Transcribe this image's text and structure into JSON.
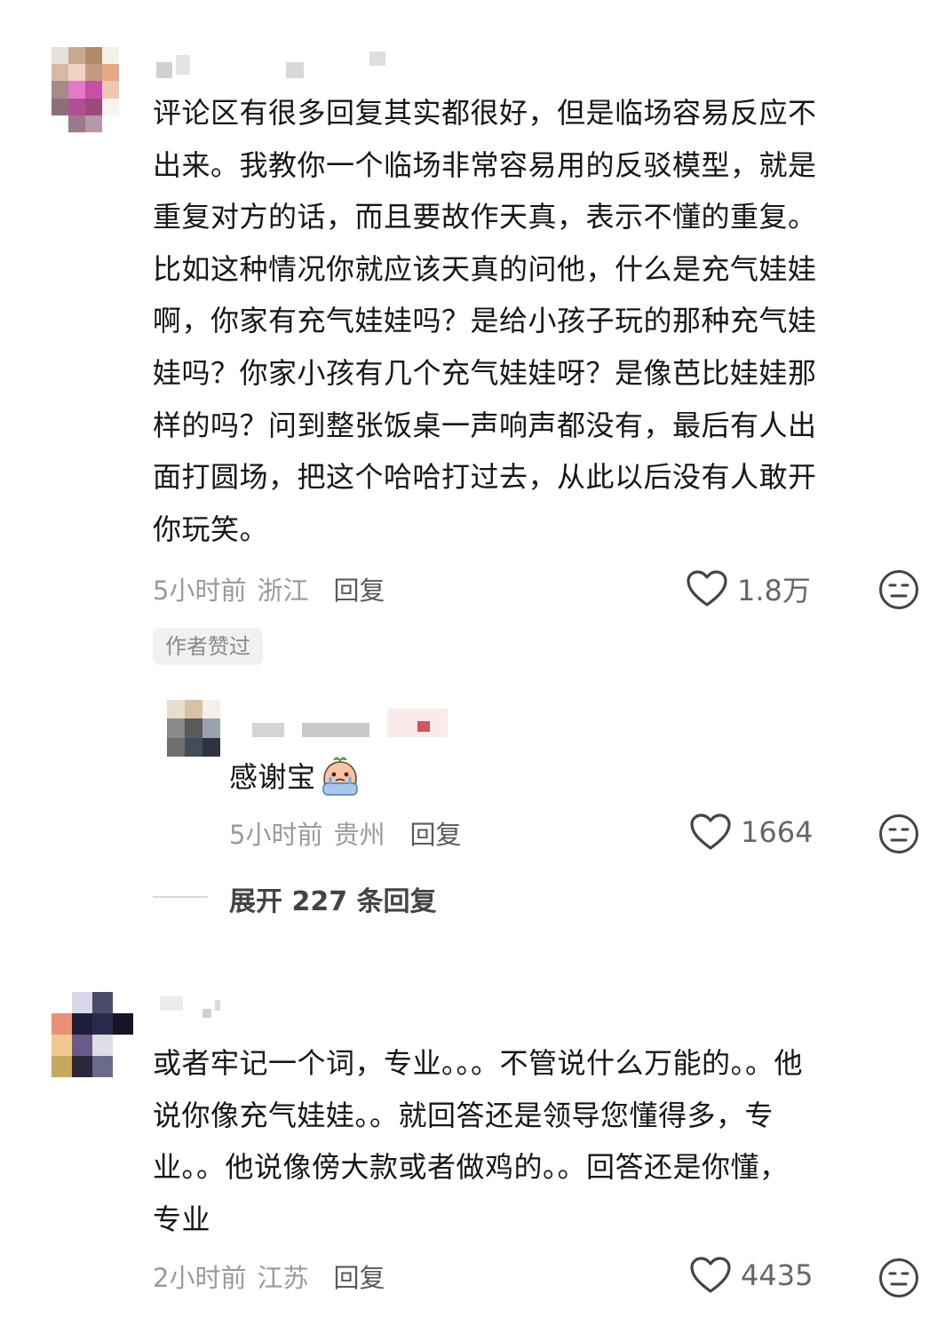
{
  "comments": [
    {
      "text": "评论区有很多回复其实都很好，但是临场容易反应不\n出来。我教你一个临场非常容易用的反驳模型，就是\n重复对方的话，而且要故作天真，表示不懂的重复。\n比如这种情况你就应该天真的问他，什么是充气娃娃\n啊，你家有充气娃娃吗？是给小孩子玩的那种充气娃\n娃吗？你家小孩有几个充气娃娃呀？是像芭比娃娃那\n样的吗？问到整张饭桌一声响声都没有，最后有人出\n面打圆场，把这个哈哈打过去，从此以后没有人敢开\n你玩笑。",
      "time": "5小时前",
      "location": "浙江",
      "reply_label": "回复",
      "likes": "1.8万",
      "badge": "作者赞过",
      "replies": [
        {
          "text": "感谢宝",
          "emoji": "crying-emoji",
          "time": "5小时前",
          "location": "贵州",
          "reply_label": "回复",
          "likes": "1664"
        }
      ],
      "expand_label": "展开 227 条回复"
    },
    {
      "text": "或者牢记一个词，专业。。。不管说什么万能的。。他\n说你像充气娃娃。。就回答还是领导您懂得多，专\n业。。他说像傍大款或者做鸡的。。回答还是你懂，\n专业",
      "time": "2小时前",
      "location": "江苏",
      "reply_label": "回复",
      "likes": "4435"
    }
  ],
  "icons": {
    "like": "heart-outline-icon",
    "dislike": "neutral-face-icon"
  },
  "colors": {
    "text": "#161616",
    "meta": "#9a9a9a",
    "icon": "#444444"
  }
}
